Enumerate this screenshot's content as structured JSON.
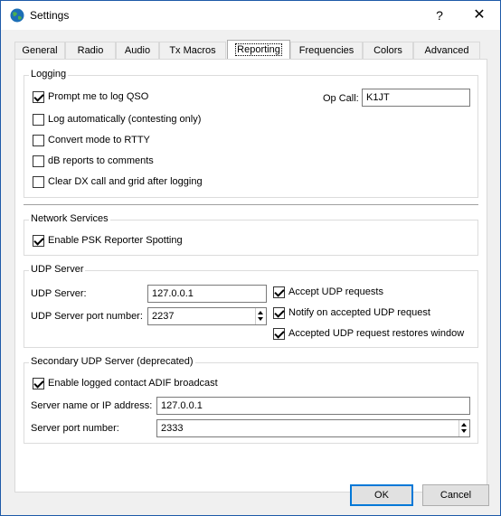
{
  "window": {
    "title": "Settings",
    "help_glyph": "?",
    "close_glyph": "✕"
  },
  "tabs": [
    {
      "label": "General"
    },
    {
      "label": "Radio"
    },
    {
      "label": "Audio"
    },
    {
      "label": "Tx Macros"
    },
    {
      "label": "Reporting",
      "active": true
    },
    {
      "label": "Frequencies"
    },
    {
      "label": "Colors"
    },
    {
      "label": "Advanced"
    }
  ],
  "logging": {
    "title": "Logging",
    "prompt_log_qso": {
      "label": "Prompt me to log QSO",
      "checked": true
    },
    "log_automatically": {
      "label": "Log automatically (contesting only)",
      "checked": false
    },
    "convert_rtty": {
      "label": "Convert mode to RTTY",
      "checked": false
    },
    "db_reports": {
      "label": "dB reports to comments",
      "checked": false
    },
    "clear_dx": {
      "label": "Clear DX call and grid after logging",
      "checked": false
    },
    "op_call_label": "Op Call:",
    "op_call_value": "K1JT"
  },
  "network": {
    "title": "Network Services",
    "psk_reporter": {
      "label": "Enable PSK Reporter Spotting",
      "checked": true
    }
  },
  "udp": {
    "title": "UDP Server",
    "server_label": "UDP Server:",
    "server_value": "127.0.0.1",
    "port_label": "UDP Server port number:",
    "port_value": "2237",
    "accept_requests": {
      "label": "Accept UDP requests",
      "checked": true
    },
    "notify_accepted": {
      "label": "Notify on accepted UDP request",
      "checked": true
    },
    "restores_window": {
      "label": "Accepted UDP request restores window",
      "checked": true
    }
  },
  "secondary_udp": {
    "title": "Secondary UDP Server (deprecated)",
    "adif_broadcast": {
      "label": "Enable logged contact ADIF broadcast",
      "checked": true
    },
    "server_label": "Server name or IP address:",
    "server_value": "127.0.0.1",
    "port_label": "Server port number:",
    "port_value": "2333"
  },
  "buttons": {
    "ok": "OK",
    "cancel": "Cancel"
  },
  "colors": {
    "accent": "#0078d7",
    "window_border": "#1e5aa8"
  }
}
